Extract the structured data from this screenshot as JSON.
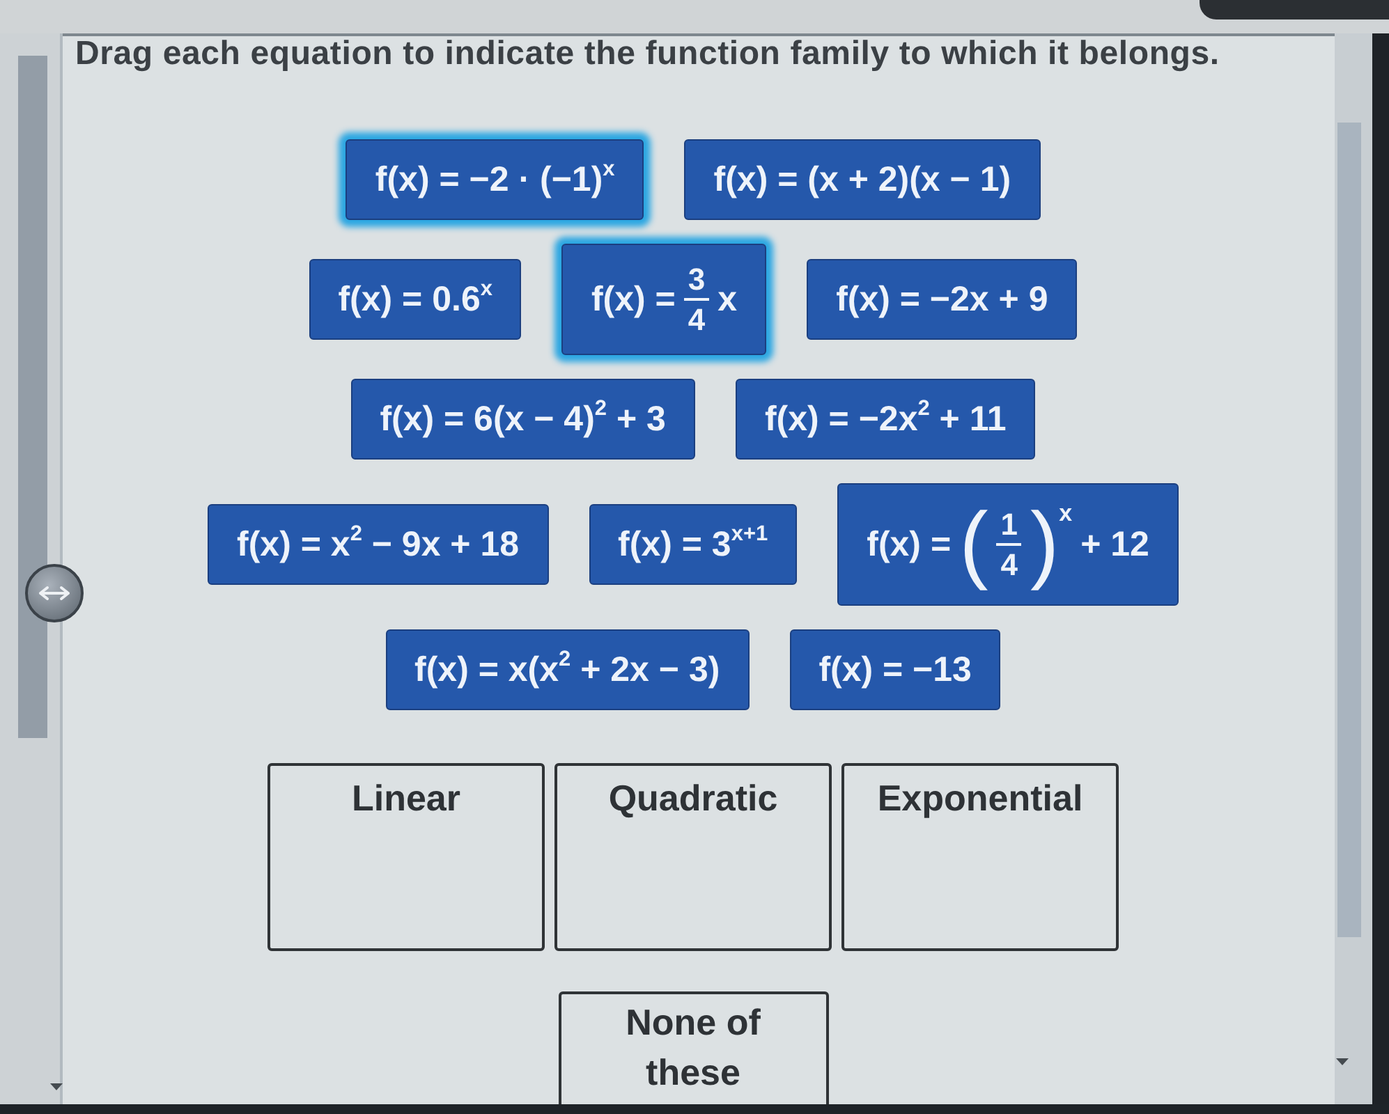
{
  "instruction": "Drag each equation to indicate the function family to which it belongs.",
  "equation_rows": [
    {
      "tiles": [
        {
          "kind": "plain",
          "text": "f(x) = −2 · (−1)$^{x}$",
          "highlighted": true
        },
        {
          "kind": "plain",
          "text": "f(x) = (x + 2)(x − 1)",
          "highlighted": false
        }
      ]
    },
    {
      "tiles": [
        {
          "kind": "plain",
          "text": "f(x) = 0.6$^{x}$",
          "highlighted": false
        },
        {
          "kind": "fraction",
          "prefix": "f(x) =",
          "numerator": "3",
          "denominator": "4",
          "suffix": "x",
          "highlighted": true
        },
        {
          "kind": "plain",
          "text": "f(x) = −2x + 9",
          "highlighted": false
        }
      ]
    },
    {
      "tiles": [
        {
          "kind": "plain",
          "text": "f(x) = 6(x − 4)$^{2}$ + 3",
          "highlighted": false
        },
        {
          "kind": "plain",
          "text": "f(x) = −2x$^{2}$ + 11",
          "highlighted": false
        }
      ]
    },
    {
      "tiles": [
        {
          "kind": "plain",
          "text": "f(x) = x$^{2}$ − 9x + 18",
          "highlighted": false
        },
        {
          "kind": "plain",
          "text": "f(x) = 3$^{x+1}$",
          "highlighted": false
        },
        {
          "kind": "fraction",
          "prefix": "f(x) =",
          "open": "(",
          "numerator": "1",
          "denominator": "4",
          "close": ")",
          "exponent": "x",
          "suffix": "+ 12",
          "highlighted": false
        }
      ]
    },
    {
      "tiles": [
        {
          "kind": "plain",
          "text": "f(x) = x(x$^{2}$ + 2x − 3)",
          "highlighted": false
        },
        {
          "kind": "plain",
          "text": "f(x) = −13",
          "highlighted": false
        }
      ]
    }
  ],
  "bin_rows": [
    {
      "bins": [
        {
          "label": "Linear"
        },
        {
          "label": "Quadratic"
        },
        {
          "label": "Exponential"
        }
      ]
    },
    {
      "bins": [
        {
          "label": "None of these"
        }
      ]
    }
  ]
}
